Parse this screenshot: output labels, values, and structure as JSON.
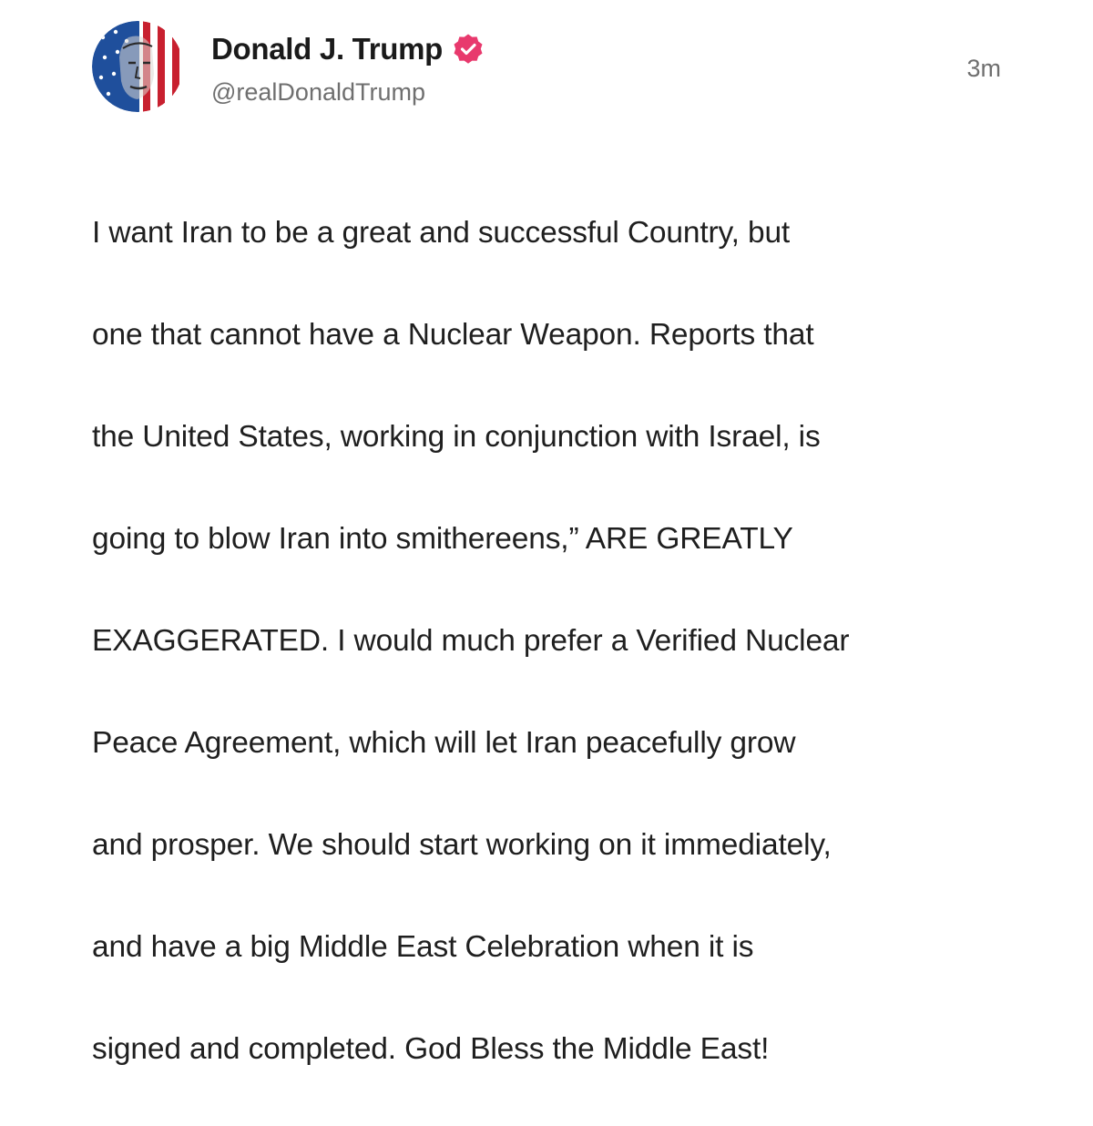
{
  "post": {
    "author": {
      "display_name": "Donald J. Trump",
      "handle": "@realDonaldTrump",
      "verified": true,
      "verified_icon": "verified-badge-icon",
      "avatar_icon": "avatar-flag-portrait"
    },
    "timestamp": "3m",
    "body_lines": [
      "I want Iran to be a great and successful Country, but",
      "one that cannot have a Nuclear Weapon. Reports that",
      "the United States, working in conjunction with Israel, is",
      "going to blow Iran into smithereens,” ARE GREATLY",
      "EXAGGERATED. I would much prefer a Verified Nuclear",
      "Peace Agreement, which will let Iran peacefully grow",
      "and prosper. We should start working on it immediately,",
      "and have a big Middle East Celebration when it is",
      "signed and completed. God Bless the Middle East!"
    ]
  },
  "colors": {
    "badge": "#e8396d",
    "name": "#1a1a1a",
    "secondary_text": "#6f6f6f",
    "body_text": "#1f1f1f",
    "flag_red": "#c8202f",
    "flag_blue": "#1f4f9c"
  }
}
